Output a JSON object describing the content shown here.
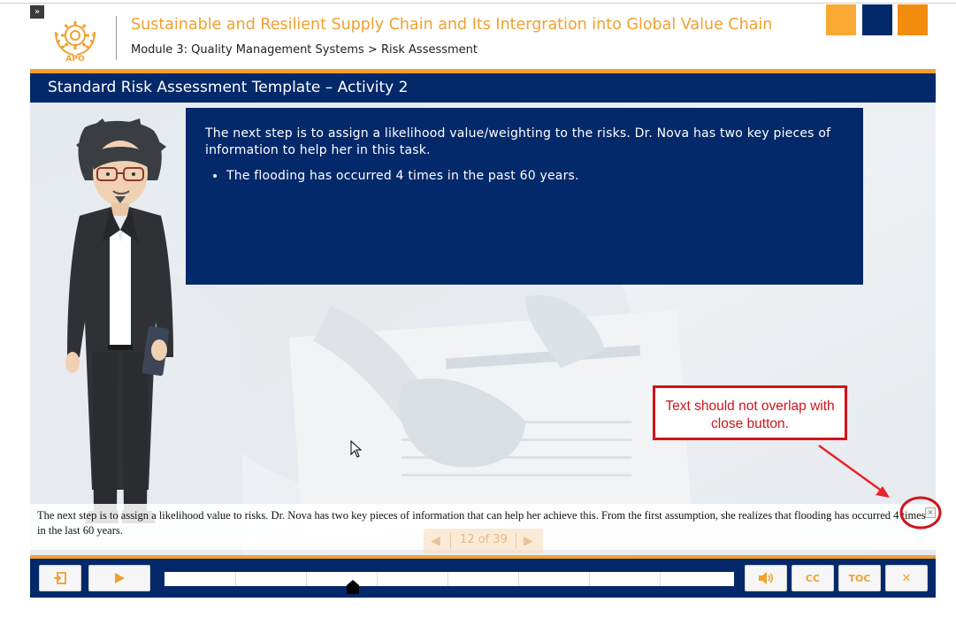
{
  "header": {
    "expand_label": "»",
    "course_title": "Sustainable and Resilient Supply Chain and Its Intergration into Global Value Chain",
    "breadcrumb": "Module 3: Quality Management Systems > Risk Assessment",
    "logo_text": "APO",
    "brand_colors": [
      "#f9aa33",
      "#03296b",
      "#f28c0f"
    ]
  },
  "slide": {
    "title": "Standard Risk Assessment Template – Activity 2",
    "info_text": "The next step is to assign a likelihood value/weighting to the risks. Dr. Nova has two key pieces of information to help her in this task.",
    "bullets": [
      "The flooding has occurred 4 times in the past 60 years."
    ]
  },
  "caption": {
    "text": "The next step is to assign a likelihood value to risks. Dr. Nova has two key pieces of information that can help her achieve this. From the first assumption, she realizes that flooding has occurred 4 times in the last 60 years.",
    "close_label": "×"
  },
  "pager": {
    "counter": "12 of 39",
    "prev_label": "◀",
    "next_label": "▶"
  },
  "controls": {
    "exit_icon": "exit-icon",
    "play_icon": "play-icon",
    "volume_icon": "volume-icon",
    "cc_label": "CC",
    "toc_label": "TOC",
    "close_label": "✕",
    "progress_fraction": 0.33
  },
  "annotation": {
    "text": "Text should not overlap with close button.",
    "color": "#d0131b"
  }
}
